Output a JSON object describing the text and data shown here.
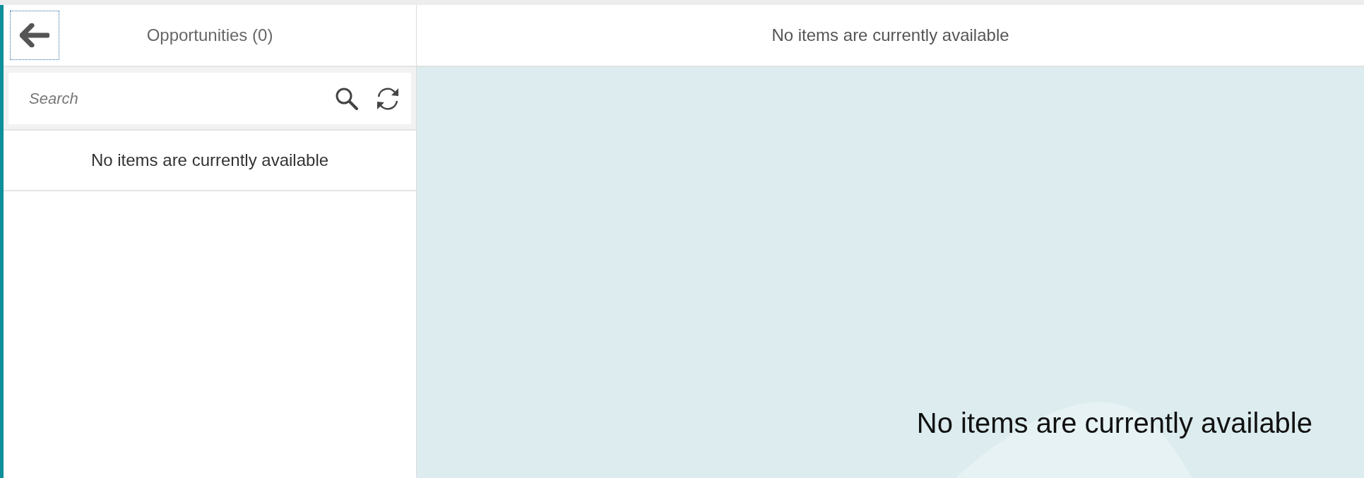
{
  "master": {
    "title": "Opportunities (0)",
    "search": {
      "placeholder": "Search"
    },
    "no_data": "No items are currently available"
  },
  "detail": {
    "title": "No items are currently available",
    "message": "No items are currently available"
  }
}
